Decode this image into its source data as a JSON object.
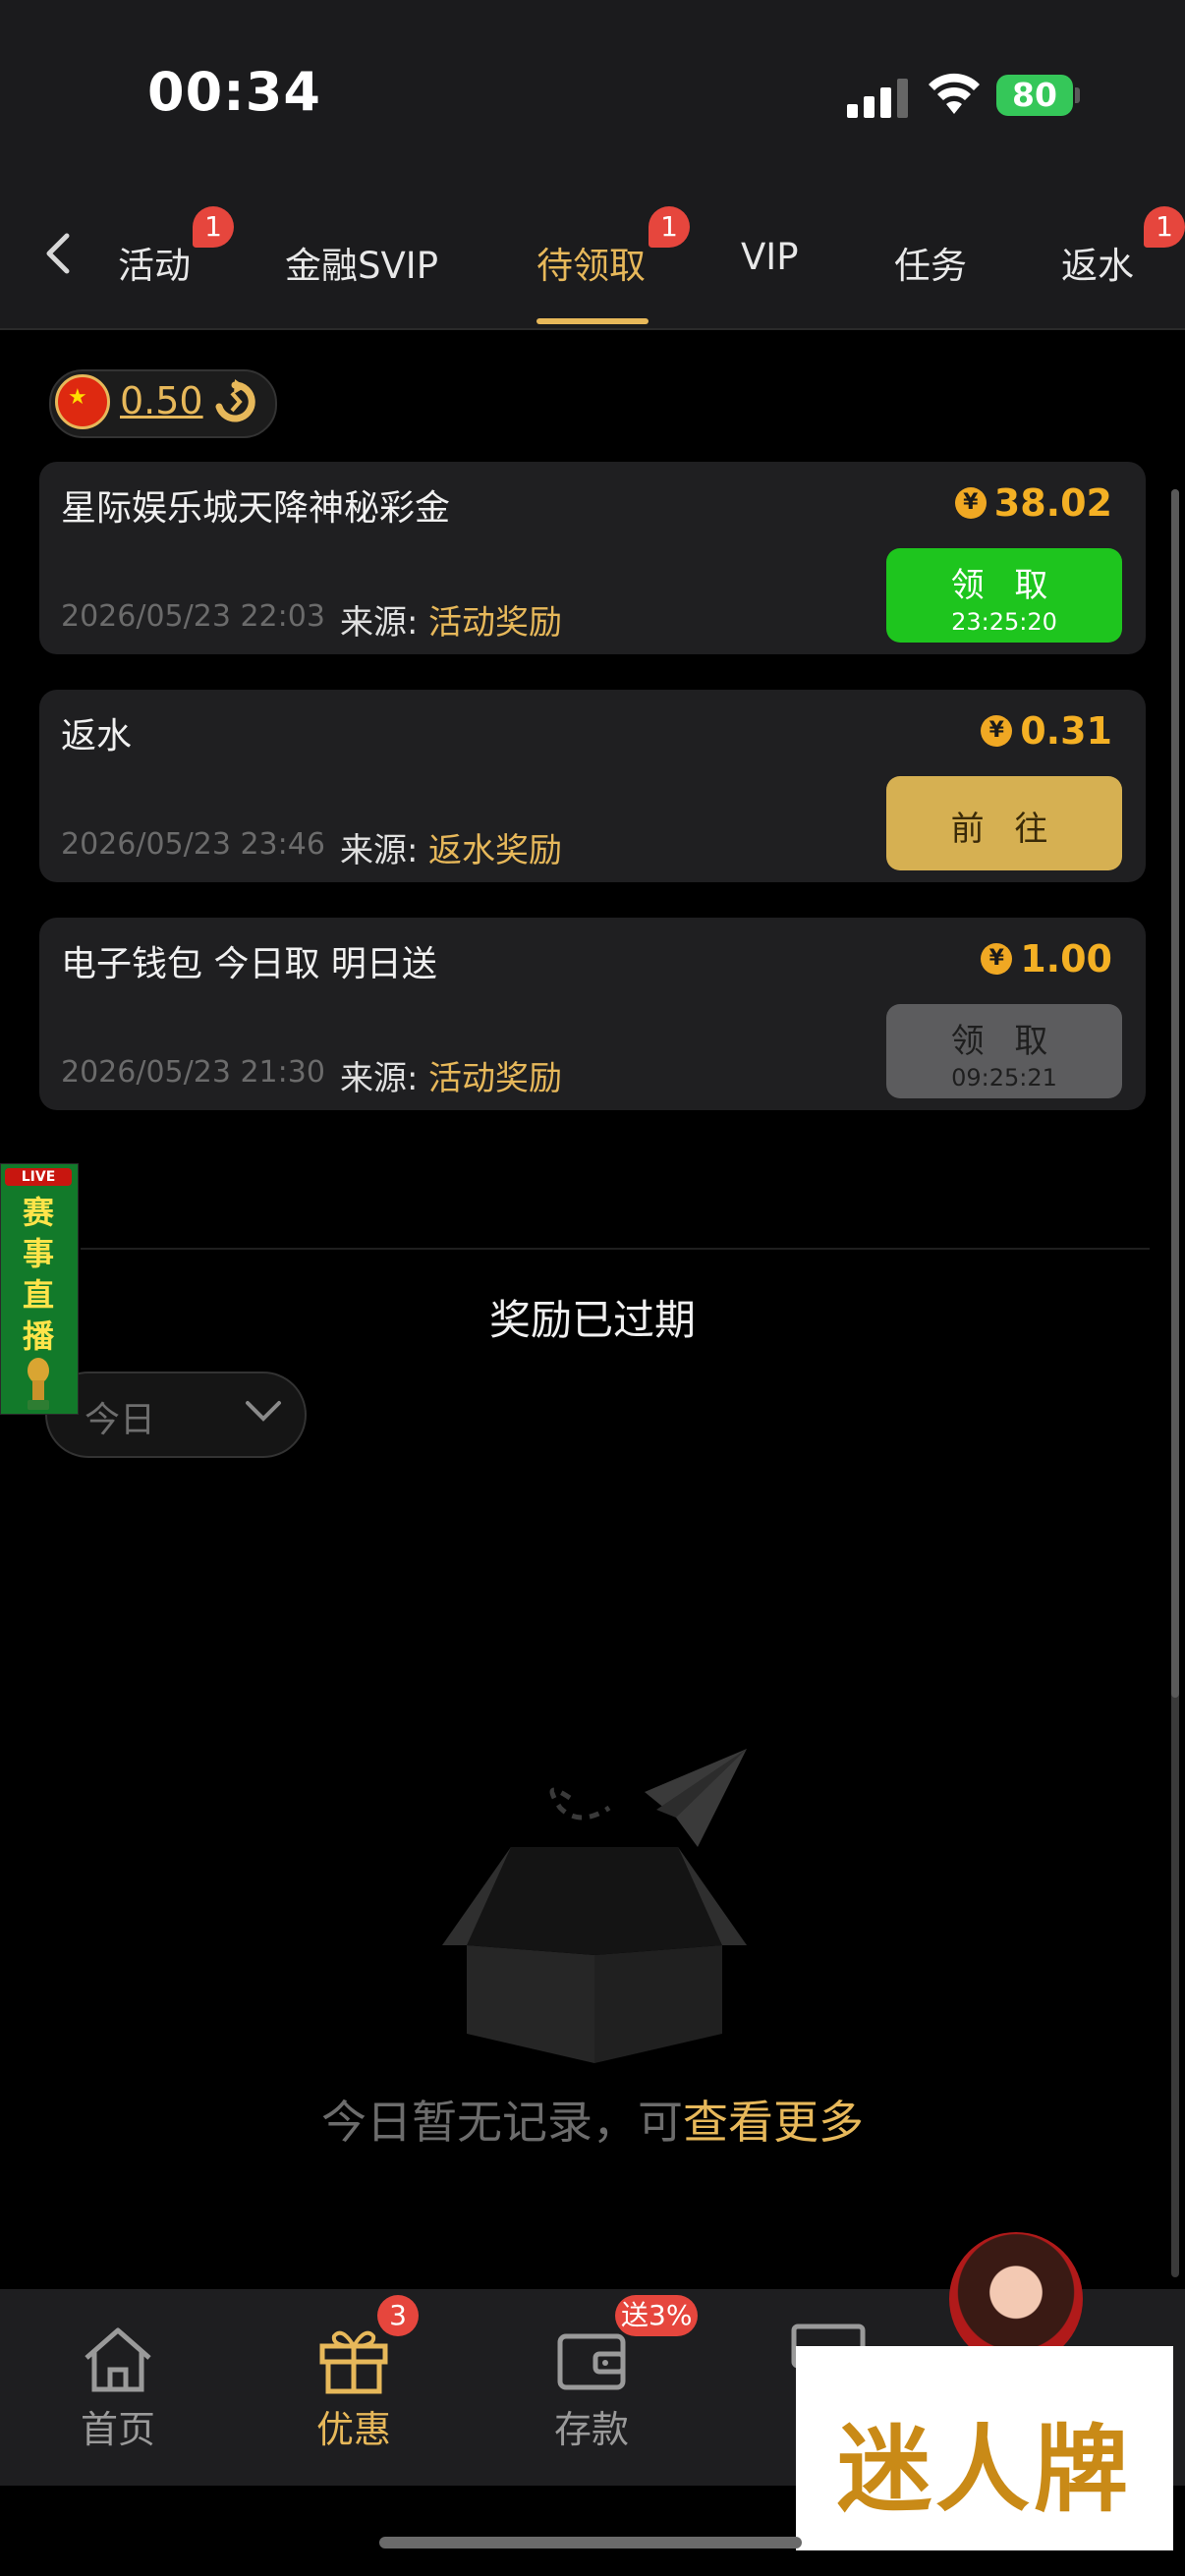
{
  "status_bar": {
    "time": "00:34",
    "battery": "80"
  },
  "tabs": [
    {
      "label": "活动",
      "badge": "1"
    },
    {
      "label": "金融SVIP"
    },
    {
      "label": "待领取",
      "badge": "1",
      "active": true
    },
    {
      "label": "VIP"
    },
    {
      "label": "任务"
    },
    {
      "label": "返水",
      "badge": "1"
    }
  ],
  "balance": {
    "value": "0.50"
  },
  "rewards": [
    {
      "title": "星际娱乐城天降神秘彩金",
      "amount": "38.02",
      "date": "2026/05/23 22:03",
      "source_label": "来源:",
      "source": "活动奖励",
      "button": "领 取",
      "timer": "23:25:20",
      "button_style": "green"
    },
    {
      "title": "返水",
      "amount": "0.31",
      "date": "2026/05/23 23:46",
      "source_label": "来源:",
      "source": "返水奖励",
      "button": "前 往",
      "button_style": "gold"
    },
    {
      "title": "电子钱包 今日取 明日送",
      "amount": "1.00",
      "date": "2026/05/23 21:30",
      "source_label": "来源:",
      "source": "活动奖励",
      "button": "领 取",
      "timer": "09:25:21",
      "button_style": "disabled"
    }
  ],
  "expired": {
    "title": "奖励已过期",
    "filter": "今日",
    "empty_text": "今日暂无记录，可",
    "empty_link": "查看更多"
  },
  "live_banner": {
    "tag": "LIVE",
    "text": "赛事直播"
  },
  "bottom_nav": [
    {
      "label": "首页"
    },
    {
      "label": "优惠",
      "badge": "3",
      "active": true
    },
    {
      "label": "存款",
      "badge": "送3%"
    }
  ],
  "brand": {
    "text": "迷人牌"
  },
  "colors": {
    "accent": "#e7b85a",
    "badge": "#e6463d",
    "green_button": "#1ec51e",
    "gold_button": "#d6b052",
    "disabled_button": "#5c5c5e"
  }
}
